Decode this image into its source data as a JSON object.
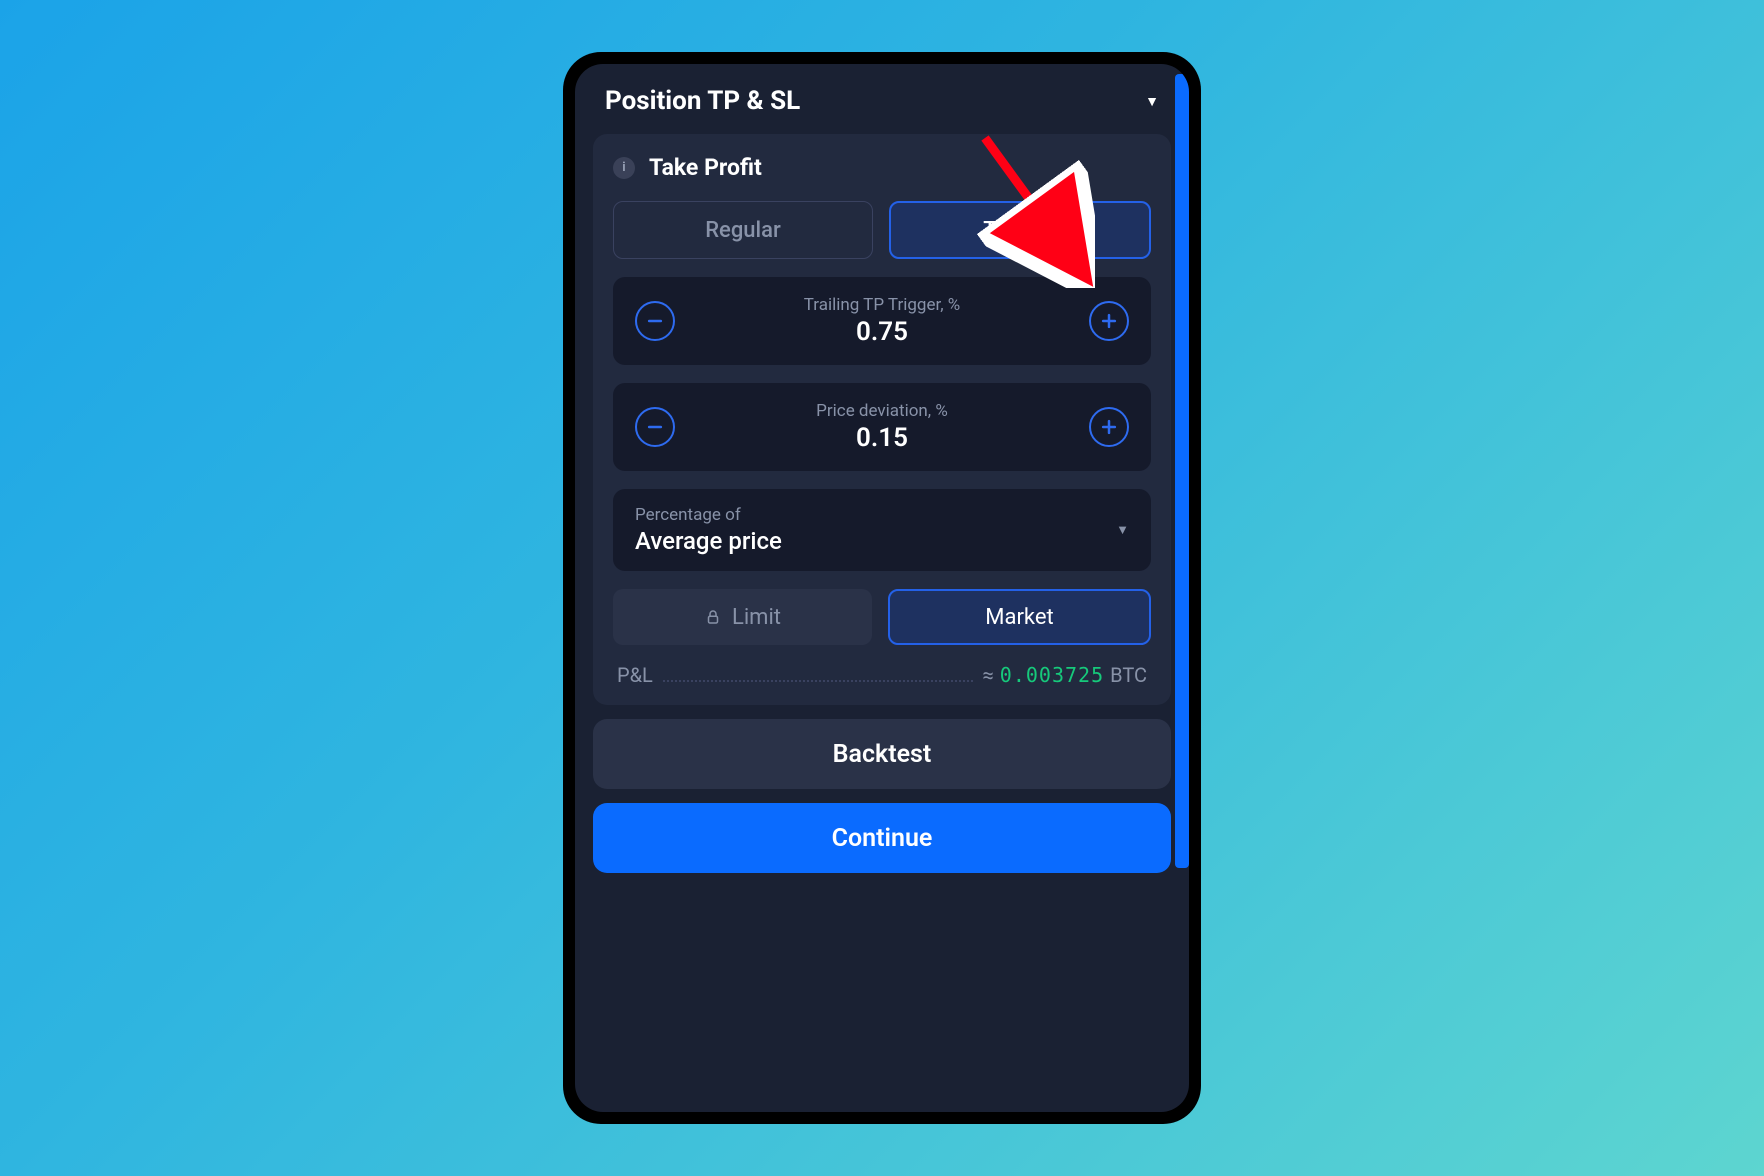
{
  "header": {
    "title": "Position TP & SL"
  },
  "takeProfit": {
    "section_title": "Take Profit",
    "tabs": {
      "regular": "Regular",
      "trailing": "Trailing"
    },
    "trigger": {
      "label": "Trailing TP Trigger, %",
      "value": "0.75"
    },
    "deviation": {
      "label": "Price deviation, %",
      "value": "0.15"
    },
    "percentage_of": {
      "label": "Percentage of",
      "value": "Average price"
    },
    "orderType": {
      "limit": "Limit",
      "market": "Market"
    },
    "pnl": {
      "label": "P&L",
      "approx": "≈",
      "value": "0.003725",
      "unit": "BTC"
    }
  },
  "buttons": {
    "backtest": "Backtest",
    "continue": "Continue"
  }
}
